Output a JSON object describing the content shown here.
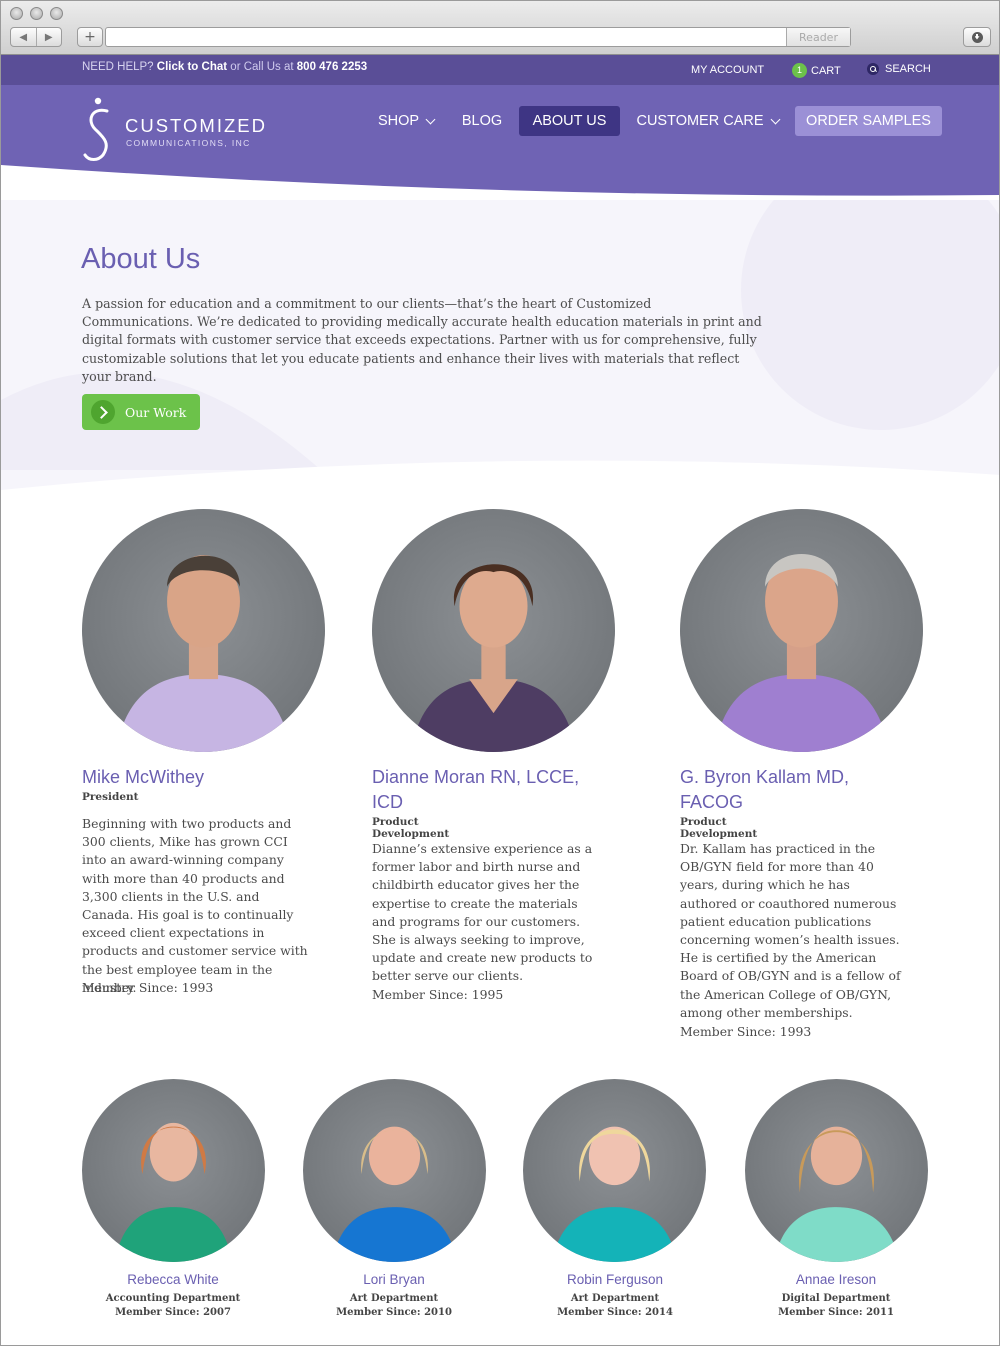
{
  "browser": {
    "reader_label": "Reader"
  },
  "topbar": {
    "need_help": "NEED HELP?",
    "chat": "Click to Chat",
    "or_call": "or Call Us at",
    "phone": "800 476 2253",
    "my_account": "MY ACCOUNT",
    "cart_count": "1",
    "cart": "CART",
    "search": "SEARCH"
  },
  "logo": {
    "line1": "CUSTOMIZED",
    "line2": "COMMUNICATIONS, INC"
  },
  "nav": {
    "shop": "SHOP",
    "blog": "BLOG",
    "about": "ABOUT US",
    "care": "CUSTOMER CARE",
    "samples": "ORDER SAMPLES"
  },
  "hero": {
    "title": "About Us",
    "body": "A passion for education and a commitment to our clients—that’s the heart of Customized Communications. We’re dedicated to providing medically accurate health education materials in print and digital formats with customer service that exceeds expectations. Partner with us for comprehensive, fully customizable solutions that let you educate patients and enhance their lives with materials that reflect your brand.",
    "button": "Our Work"
  },
  "leaders": [
    {
      "name": "Mike McWithey",
      "role": "President",
      "bio": "Beginning with two products and 300 clients, Mike has grown CCI into an award-winning company with more than 40 products and 3,300 clients in the U.S. and Canada. His goal is to continually exceed client expectations in products and customer service with the best employee team in the industry.",
      "since": "Member Since: 1993"
    },
    {
      "name": "Dianne Moran RN, LCCE, ICD",
      "role": "Product Development",
      "bio": "Dianne’s extensive experience as a former labor and birth nurse and childbirth educator gives her the expertise to create the materials and programs for our customers. She is always seeking to improve, update and create new products to better serve our clients.",
      "since": "Member Since: 1995"
    },
    {
      "name": "G. Byron Kallam MD, FACOG",
      "role": "Product Development",
      "bio": "Dr. Kallam has practiced in the OB/GYN field for more than 40 years, during which he has authored or coauthored numerous patient education publications concerning women’s health issues. He is certified by the American Board of OB/GYN and is a fellow of the American College of OB/GYN, among other memberships.",
      "since": "Member Since: 1993"
    }
  ],
  "staff": [
    {
      "name": "Rebecca White",
      "dept": "Accounting Department",
      "since": "Member Since: 2007"
    },
    {
      "name": "Lori Bryan",
      "dept": "Art Department",
      "since": "Member Since: 2010"
    },
    {
      "name": "Robin Ferguson",
      "dept": "Art Department",
      "since": "Member Since: 2014"
    },
    {
      "name": "Annae Ireson",
      "dept": "Digital Department",
      "since": "Member Since: 2011"
    }
  ],
  "colors": {
    "brand_purple": "#6a5fb1",
    "topbar": "#5a4e97",
    "header": "#6f63b4",
    "green": "#6cc24a"
  }
}
